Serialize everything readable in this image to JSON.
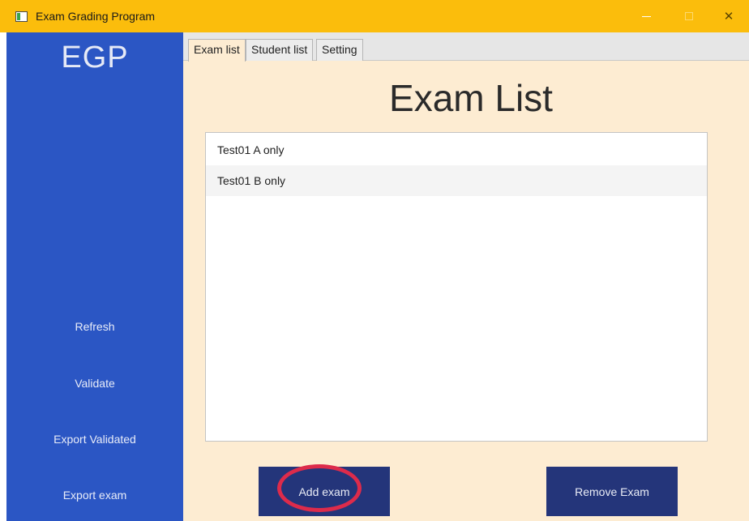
{
  "window": {
    "title": "Exam Grading Program",
    "close_glyph": "✕"
  },
  "sidebar": {
    "brand": "EGP",
    "items": [
      {
        "label": "Refresh"
      },
      {
        "label": "Validate"
      },
      {
        "label": "Export Validated"
      },
      {
        "label": "Export exam"
      }
    ]
  },
  "tabs": [
    {
      "label": "Exam list",
      "active": true
    },
    {
      "label": "Student list",
      "active": false
    },
    {
      "label": "Setting",
      "active": false
    }
  ],
  "main": {
    "title": "Exam List",
    "exams": [
      {
        "name": "Test01 A only"
      },
      {
        "name": "Test01 B only"
      }
    ],
    "add_button": "Add exam",
    "remove_button": "Remove Exam"
  },
  "colors": {
    "titlebar": "#fbbd0c",
    "sidebar": "#2b56c4",
    "main_bg": "#fdecd2",
    "button": "#24357a",
    "highlight_ring": "#dd2b4b"
  },
  "icons": {
    "app": "app-window-icon",
    "minimize": "minimize-icon",
    "maximize": "maximize-icon",
    "close": "close-icon"
  }
}
